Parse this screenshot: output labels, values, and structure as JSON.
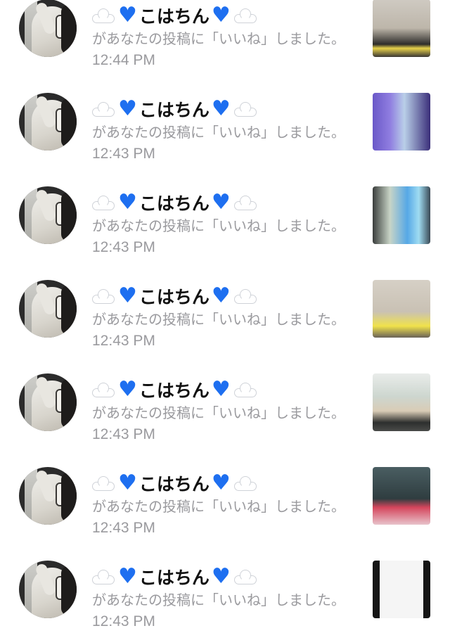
{
  "notifications": [
    {
      "name": "こはちん",
      "action": "があなたの投稿に「いいね」しました。",
      "time": "12:44 PM",
      "thumb": "t1"
    },
    {
      "name": "こはちん",
      "action": "があなたの投稿に「いいね」しました。",
      "time": "12:43 PM",
      "thumb": "t2"
    },
    {
      "name": "こはちん",
      "action": "があなたの投稿に「いいね」しました。",
      "time": "12:43 PM",
      "thumb": "t3"
    },
    {
      "name": "こはちん",
      "action": "があなたの投稿に「いいね」しました。",
      "time": "12:43 PM",
      "thumb": "t4"
    },
    {
      "name": "こはちん",
      "action": "があなたの投稿に「いいね」しました。",
      "time": "12:43 PM",
      "thumb": "t5"
    },
    {
      "name": "こはちん",
      "action": "があなたの投稿に「いいね」しました。",
      "time": "12:43 PM",
      "thumb": "t6"
    },
    {
      "name": "こはちん",
      "action": "があなたの投稿に「いいね」しました。",
      "time": "12:43 PM",
      "thumb": "t7"
    }
  ],
  "icons": {
    "name_prefix": [
      "cloud-icon",
      "blue-heart-icon"
    ],
    "name_suffix": [
      "blue-heart-icon",
      "cloud-icon"
    ]
  },
  "colors": {
    "heart": "#1e6ff0",
    "secondary_text": "#9a9a9e",
    "primary_text": "#111111",
    "background": "#ffffff"
  }
}
